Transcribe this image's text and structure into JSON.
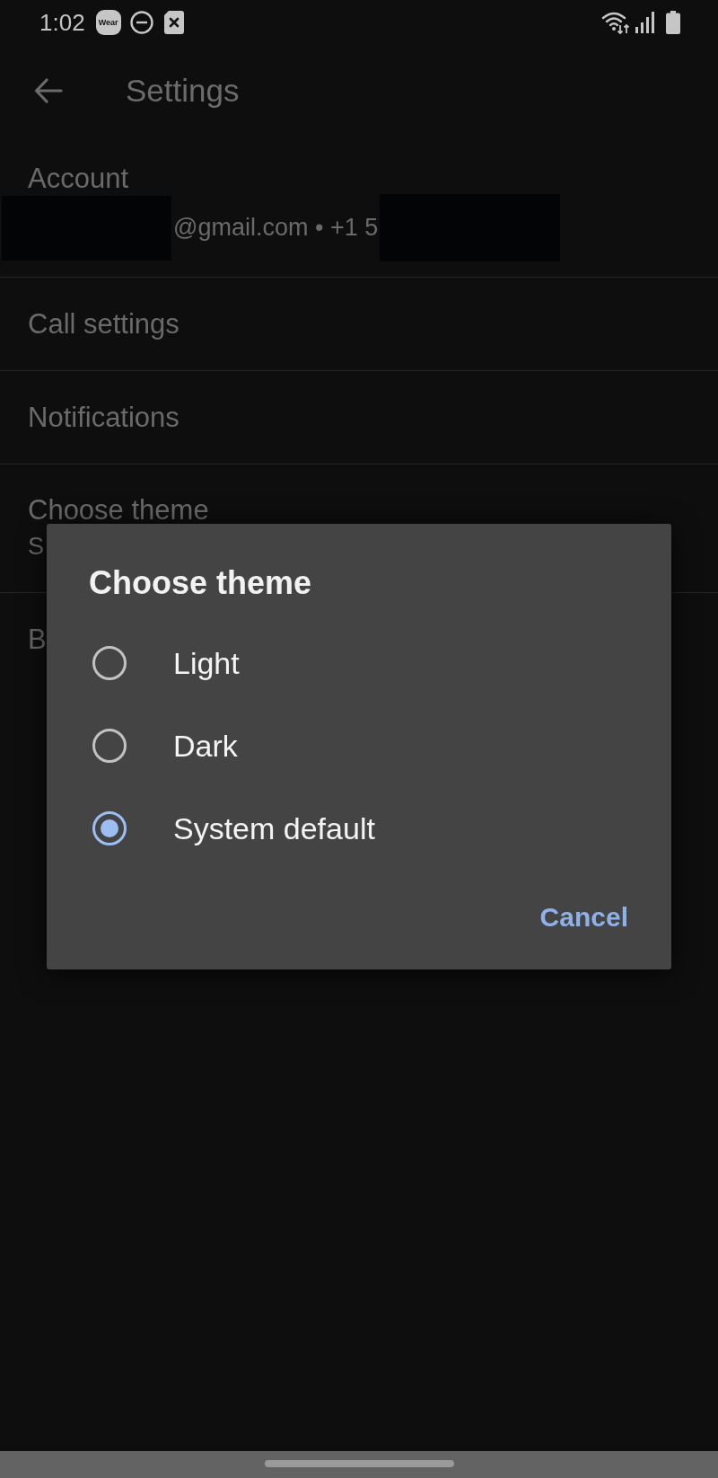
{
  "status_bar": {
    "time": "1:02",
    "notification_badge": "Wear"
  },
  "toolbar": {
    "title": "Settings"
  },
  "settings": [
    {
      "kind": "account",
      "title": "Account",
      "subtitle": "@gmail.com • +1 5"
    },
    {
      "kind": "setting",
      "title": "Call settings"
    },
    {
      "kind": "setting",
      "title": "Notifications"
    },
    {
      "kind": "setting",
      "title": "Choose theme",
      "subtitle": "S"
    },
    {
      "kind": "setting",
      "title": "B"
    }
  ],
  "dialog": {
    "title": "Choose theme",
    "options": [
      {
        "label": "Light",
        "selected": false
      },
      {
        "label": "Dark",
        "selected": false
      },
      {
        "label": "System default",
        "selected": true
      }
    ],
    "buttons": [
      "Cancel"
    ]
  }
}
